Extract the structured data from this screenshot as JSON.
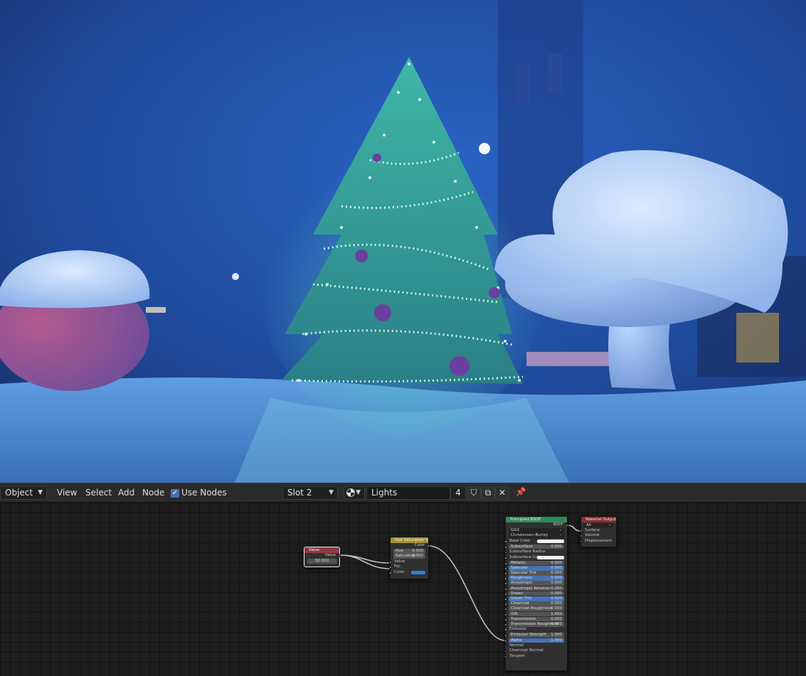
{
  "header": {
    "mode": "Object",
    "menu": [
      "View",
      "Select",
      "Add",
      "Node"
    ],
    "use_nodes_label": "Use Nodes",
    "use_nodes_checked": true,
    "slot": "Slot 2",
    "material_name": "Lights",
    "user_count": "4"
  },
  "nodes": {
    "value": {
      "title": "Value",
      "output_label": "Value",
      "value": "50.000"
    },
    "hue_sat": {
      "title": "Hue Saturation Value",
      "output_label": "Color",
      "hue_label": "Hue",
      "hue_value": "0.500",
      "saturation_label": "Saturation",
      "saturation_value": "1.000",
      "value_label": "Value",
      "fac_label": "Fac",
      "color_label": "Color",
      "color_swatch": "#2f7fe0"
    },
    "bsdf": {
      "title": "Principled BSDF",
      "output_label": "BSDF",
      "distribution": "GGX",
      "subsurface_method": "Christensen-Burley",
      "rows": [
        {
          "label": "Base Color",
          "value": "",
          "type": "color"
        },
        {
          "label": "Subsurface",
          "value": "0.000",
          "type": "field"
        },
        {
          "label": "Subsurface Radius",
          "value": "",
          "type": "label"
        },
        {
          "label": "Subsurface Colo",
          "value": "",
          "type": "color"
        },
        {
          "label": "Metallic",
          "value": "0.000",
          "type": "field"
        },
        {
          "label": "Specular",
          "value": "0.500",
          "type": "blue"
        },
        {
          "label": "Specular Tint",
          "value": "0.000",
          "type": "field"
        },
        {
          "label": "Roughness",
          "value": "0.500",
          "type": "blue"
        },
        {
          "label": "Anisotropic",
          "value": "0.000",
          "type": "field"
        },
        {
          "label": "Anisotropic Rotation",
          "value": "0.000",
          "type": "field"
        },
        {
          "label": "Sheen",
          "value": "0.000",
          "type": "field"
        },
        {
          "label": "Sheen Tint",
          "value": "0.500",
          "type": "blue"
        },
        {
          "label": "Clearcoat",
          "value": "0.000",
          "type": "field"
        },
        {
          "label": "Clearcoat Roughness",
          "value": "0.030",
          "type": "field"
        },
        {
          "label": "IOR",
          "value": "1.450",
          "type": "field"
        },
        {
          "label": "Transmission",
          "value": "0.000",
          "type": "field"
        },
        {
          "label": "Transmission Roughness",
          "value": "0.000",
          "type": "field"
        },
        {
          "label": "Emission",
          "value": "",
          "type": "label"
        },
        {
          "label": "Emission Strength",
          "value": "1.000",
          "type": "field"
        },
        {
          "label": "Alpha",
          "value": "1.000",
          "type": "blue"
        },
        {
          "label": "Normal",
          "value": "",
          "type": "label"
        },
        {
          "label": "Clearcoat Normal",
          "value": "",
          "type": "label"
        },
        {
          "label": "Tangent",
          "value": "",
          "type": "label"
        }
      ]
    },
    "output": {
      "title": "Material Output",
      "target": "All",
      "inputs": [
        "Surface",
        "Volume",
        "Displacement"
      ]
    }
  },
  "colors": {
    "value_node_header": "#8f3a45",
    "color_node_header": "#a39333",
    "shader_node_header": "#2f8a5a",
    "output_node_header": "#8f2a35"
  }
}
